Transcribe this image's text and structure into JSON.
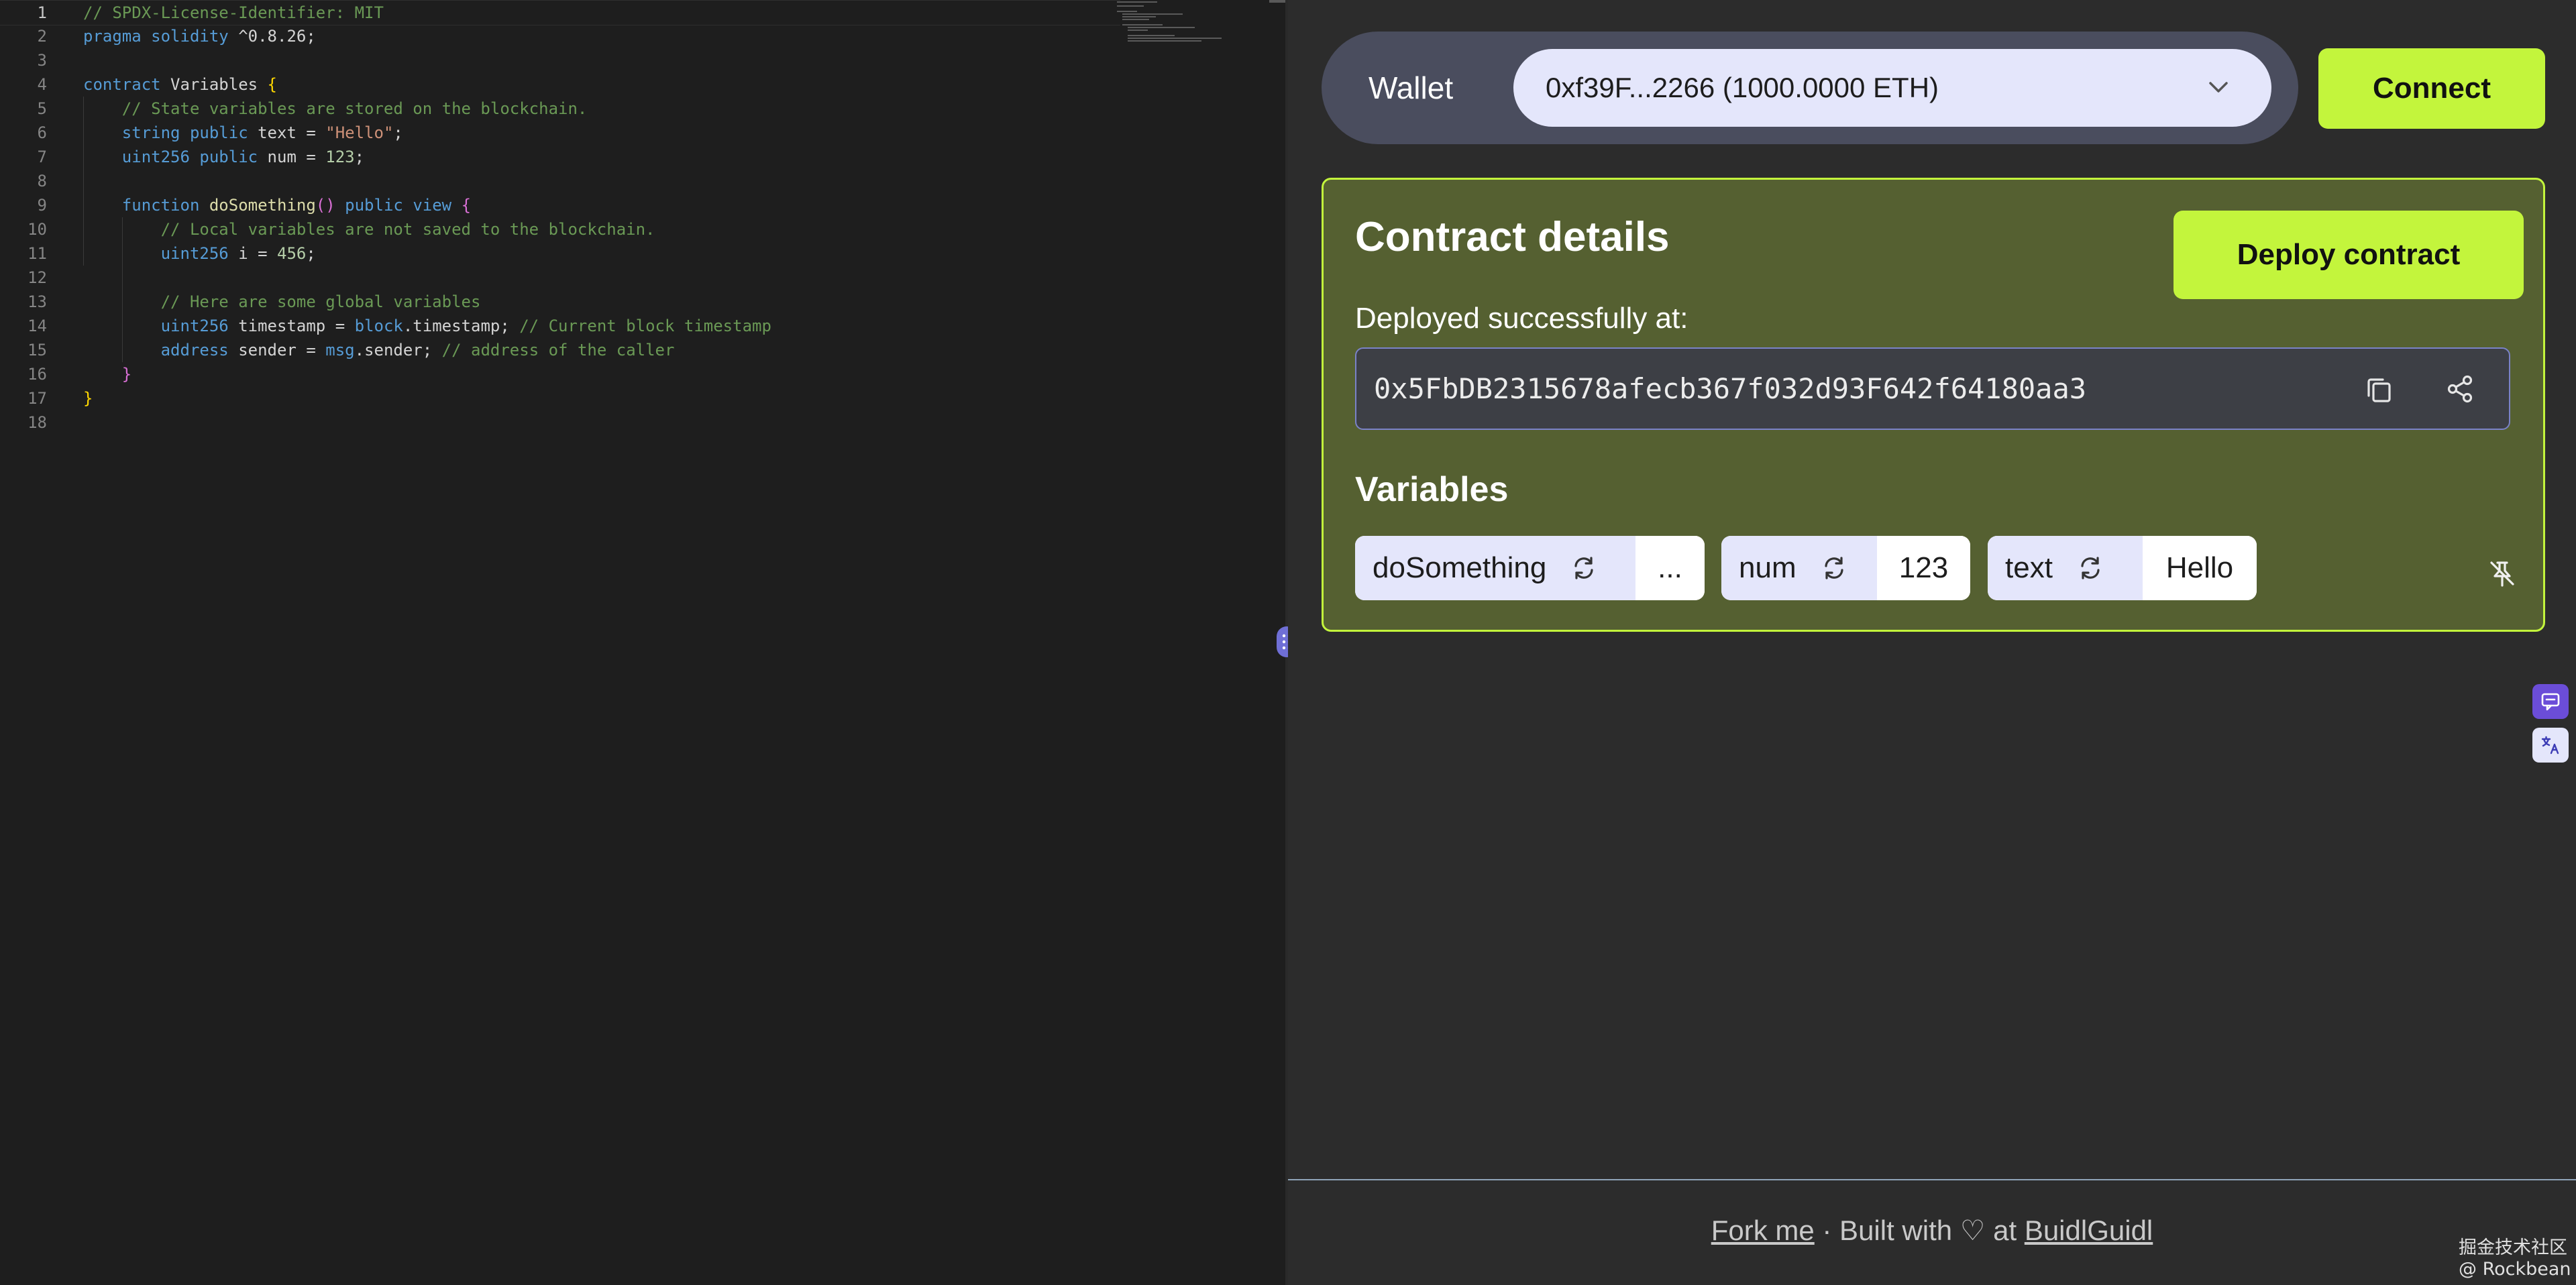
{
  "editor": {
    "lines": [
      {
        "num": "1",
        "tokens": [
          {
            "t": "// SPDX-License-Identifier: MIT",
            "c": "t-comment"
          }
        ]
      },
      {
        "num": "2",
        "tokens": [
          {
            "t": "pragma",
            "c": "t-kw"
          },
          {
            "t": " ",
            "c": "t-plain"
          },
          {
            "t": "solidity",
            "c": "t-kw"
          },
          {
            "t": " ^0.8.26;",
            "c": "t-plain"
          }
        ]
      },
      {
        "num": "3",
        "tokens": []
      },
      {
        "num": "4",
        "tokens": [
          {
            "t": "contract",
            "c": "t-kw"
          },
          {
            "t": " Variables ",
            "c": "t-plain"
          },
          {
            "t": "{",
            "c": "t-br1"
          }
        ]
      },
      {
        "num": "5",
        "tokens": [
          {
            "t": "    // State variables are stored on the blockchain.",
            "c": "t-comment"
          }
        ]
      },
      {
        "num": "6",
        "tokens": [
          {
            "t": "    ",
            "c": "t-plain"
          },
          {
            "t": "string",
            "c": "t-kw"
          },
          {
            "t": " ",
            "c": "t-plain"
          },
          {
            "t": "public",
            "c": "t-kw"
          },
          {
            "t": " text = ",
            "c": "t-plain"
          },
          {
            "t": "\"Hello\"",
            "c": "t-str"
          },
          {
            "t": ";",
            "c": "t-plain"
          }
        ]
      },
      {
        "num": "7",
        "tokens": [
          {
            "t": "    ",
            "c": "t-plain"
          },
          {
            "t": "uint256",
            "c": "t-kw"
          },
          {
            "t": " ",
            "c": "t-plain"
          },
          {
            "t": "public",
            "c": "t-kw"
          },
          {
            "t": " num = ",
            "c": "t-plain"
          },
          {
            "t": "123",
            "c": "t-num"
          },
          {
            "t": ";",
            "c": "t-plain"
          }
        ]
      },
      {
        "num": "8",
        "tokens": []
      },
      {
        "num": "9",
        "tokens": [
          {
            "t": "    ",
            "c": "t-plain"
          },
          {
            "t": "function",
            "c": "t-kw"
          },
          {
            "t": " ",
            "c": "t-plain"
          },
          {
            "t": "doSomething",
            "c": "t-fn"
          },
          {
            "t": "()",
            "c": "t-br2"
          },
          {
            "t": " ",
            "c": "t-plain"
          },
          {
            "t": "public",
            "c": "t-kw"
          },
          {
            "t": " ",
            "c": "t-plain"
          },
          {
            "t": "view",
            "c": "t-kw"
          },
          {
            "t": " ",
            "c": "t-plain"
          },
          {
            "t": "{",
            "c": "t-br2"
          }
        ]
      },
      {
        "num": "10",
        "tokens": [
          {
            "t": "        // Local variables are not saved to the blockchain.",
            "c": "t-comment"
          }
        ]
      },
      {
        "num": "11",
        "tokens": [
          {
            "t": "        ",
            "c": "t-plain"
          },
          {
            "t": "uint256",
            "c": "t-kw"
          },
          {
            "t": " i = ",
            "c": "t-plain"
          },
          {
            "t": "456",
            "c": "t-num"
          },
          {
            "t": ";",
            "c": "t-plain"
          }
        ]
      },
      {
        "num": "12",
        "tokens": []
      },
      {
        "num": "13",
        "tokens": [
          {
            "t": "        // Here are some global variables",
            "c": "t-comment"
          }
        ]
      },
      {
        "num": "14",
        "tokens": [
          {
            "t": "        ",
            "c": "t-plain"
          },
          {
            "t": "uint256",
            "c": "t-kw"
          },
          {
            "t": " timestamp = ",
            "c": "t-plain"
          },
          {
            "t": "block",
            "c": "t-kw"
          },
          {
            "t": ".timestamp; ",
            "c": "t-plain"
          },
          {
            "t": "// Current block timestamp",
            "c": "t-comment"
          }
        ]
      },
      {
        "num": "15",
        "tokens": [
          {
            "t": "        ",
            "c": "t-plain"
          },
          {
            "t": "address",
            "c": "t-kw"
          },
          {
            "t": " sender = ",
            "c": "t-plain"
          },
          {
            "t": "msg",
            "c": "t-kw"
          },
          {
            "t": ".sender; ",
            "c": "t-plain"
          },
          {
            "t": "// address of the caller",
            "c": "t-comment"
          }
        ]
      },
      {
        "num": "16",
        "tokens": [
          {
            "t": "    ",
            "c": "t-plain"
          },
          {
            "t": "}",
            "c": "t-br2"
          }
        ]
      },
      {
        "num": "17",
        "tokens": [
          {
            "t": "}",
            "c": "t-br1"
          }
        ]
      },
      {
        "num": "18",
        "tokens": []
      }
    ]
  },
  "wallet": {
    "label": "Wallet",
    "selected_account": "0xf39F...2266 (1000.0000 ETH)",
    "connect_label": "Connect"
  },
  "contract": {
    "title": "Contract details",
    "deploy_label": "Deploy contract",
    "deployed_label": "Deployed successfully at:",
    "address": "0x5FbDB2315678afecb367f032d93F642f64180aa3"
  },
  "variables": {
    "title": "Variables",
    "items": [
      {
        "name": "doSomething",
        "value": "..."
      },
      {
        "name": "num",
        "value": "123"
      },
      {
        "name": "text",
        "value": "Hello"
      }
    ]
  },
  "footer": {
    "fork_label": "Fork me",
    "built_with": "· Built with ♡ at",
    "buidlguidl_label": "BuidlGuidl"
  },
  "watermark": "掘金技术社区 @ Rockbean",
  "colors": {
    "accent": "#c3f53c",
    "card_bg": "#556031",
    "wallet_bar_bg": "#4a4d5e",
    "chip_name_bg": "#e4e6fb",
    "pane_bg": "#2c2c2c",
    "editor_bg": "#1e1e1e"
  },
  "icons": [
    "chevron-down-icon",
    "copy-icon",
    "share-icon",
    "refresh-icon",
    "unpin-icon",
    "drag-handle-icon",
    "chat-icon",
    "translate-icon"
  ]
}
